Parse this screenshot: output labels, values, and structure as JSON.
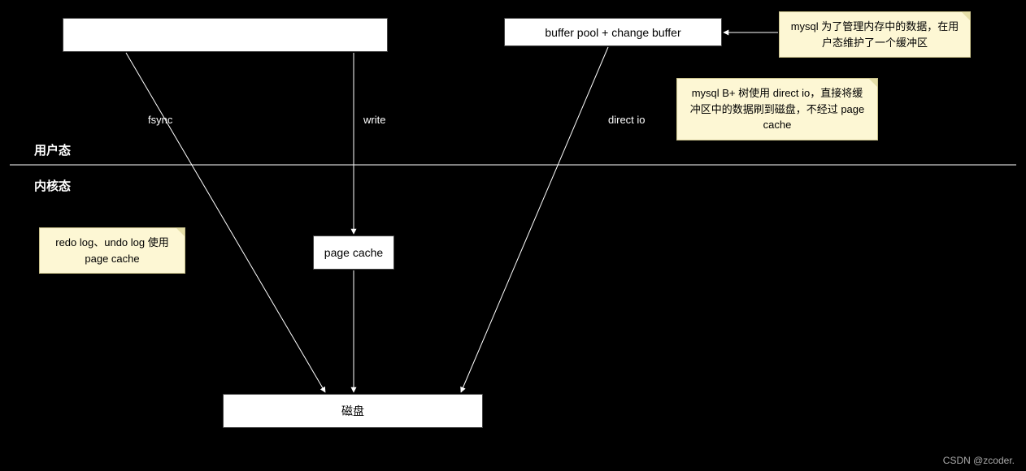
{
  "boxes": {
    "top_left": "",
    "buffer_pool": "buffer pool + change buffer",
    "page_cache": "page cache",
    "disk": "磁盘"
  },
  "notes": {
    "note1": "mysql 为了管理内存中的数据，在用户态维护了一个缓冲区",
    "note2": "mysql B+ 树使用 direct io，直接将缓冲区中的数据刷到磁盘，不经过 page cache",
    "note3": "redo log、undo log 使用 page cache"
  },
  "zones": {
    "user": "用户态",
    "kernel": "内核态"
  },
  "edges": {
    "fsync": "fsync",
    "write": "write",
    "direct_io": "direct io"
  },
  "watermark": "CSDN @zcoder."
}
